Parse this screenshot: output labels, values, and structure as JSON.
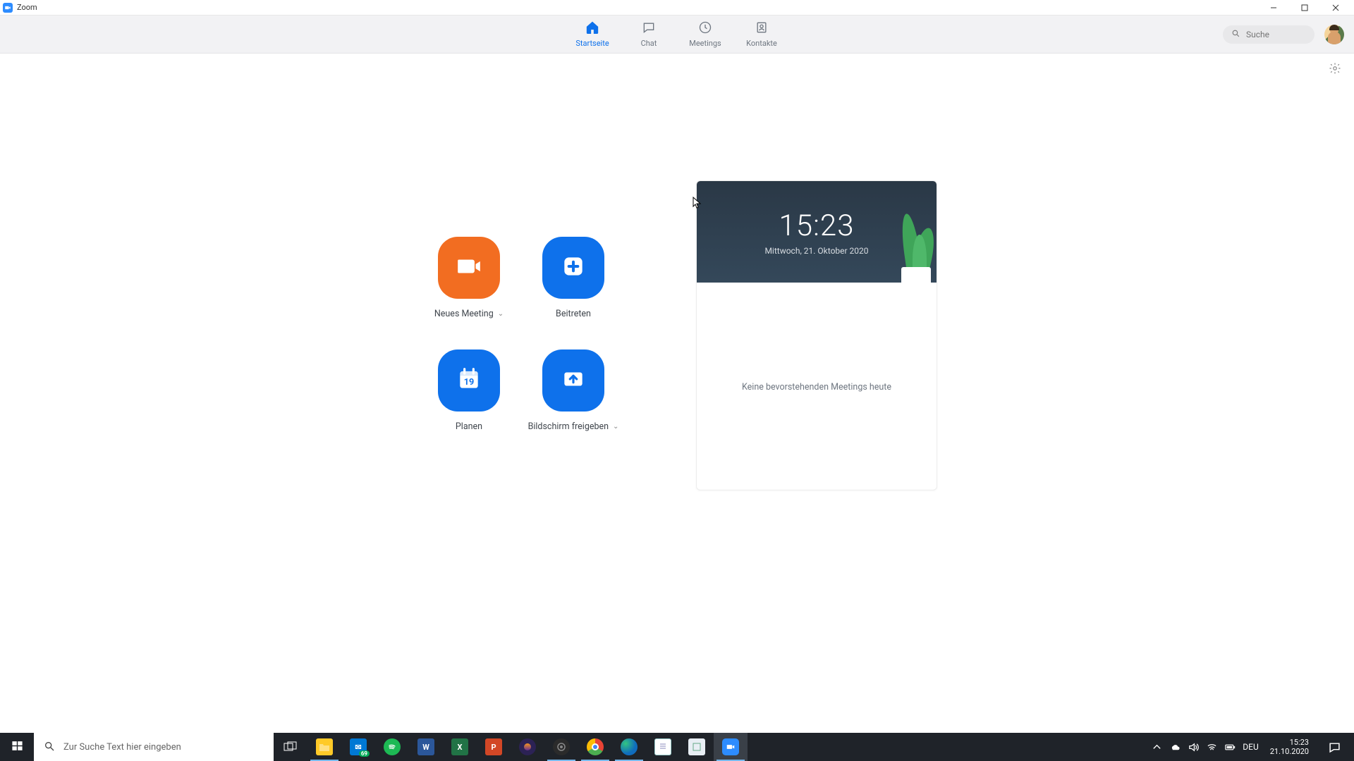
{
  "window": {
    "title": "Zoom"
  },
  "nav": {
    "tabs": [
      {
        "label": "Startseite"
      },
      {
        "label": "Chat"
      },
      {
        "label": "Meetings"
      },
      {
        "label": "Kontakte"
      }
    ],
    "search_placeholder": "Suche"
  },
  "actions": {
    "new_meeting": "Neues Meeting",
    "join": "Beitreten",
    "schedule": "Planen",
    "share_screen": "Bildschirm freigeben",
    "schedule_day": "19"
  },
  "calendar": {
    "time": "15:23",
    "date": "Mittwoch, 21. Oktober 2020",
    "empty": "Keine bevorstehenden Meetings heute"
  },
  "taskbar": {
    "search_placeholder": "Zur Suche Text hier eingeben",
    "lang": "DEU",
    "time": "15:23",
    "date": "21.10.2020",
    "mail_badge": "69"
  },
  "colors": {
    "zoom_blue": "#0E71EB",
    "zoom_orange": "#F26D21"
  }
}
